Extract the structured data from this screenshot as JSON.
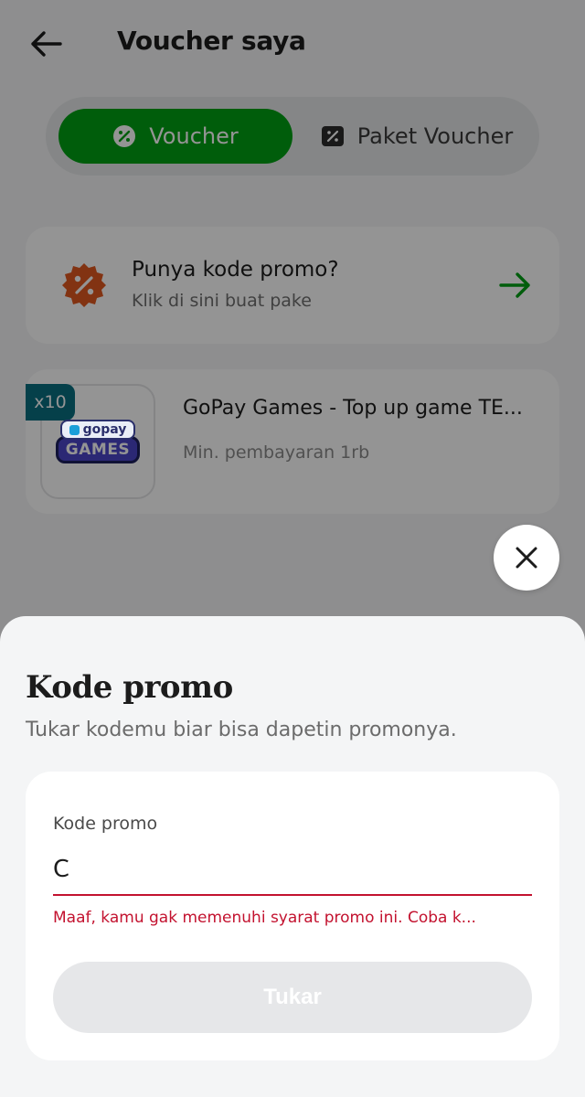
{
  "header": {
    "title": "Voucher saya",
    "back_icon": "arrow-left-icon"
  },
  "tabs": [
    {
      "label": "Voucher",
      "icon": "discount-icon",
      "active": true
    },
    {
      "label": "Paket Voucher",
      "icon": "ticket-icon",
      "active": false
    }
  ],
  "promo_entry": {
    "title": "Punya kode promo?",
    "subtitle": "Klik di sini buat pake",
    "icon": "percent-badge-icon",
    "arrow_icon": "arrow-right-icon"
  },
  "voucher": {
    "quantity": "x10",
    "logo_top": "gopay",
    "logo_bottom": "GAMES",
    "name": "GoPay Games - Top up game TE...",
    "min_payment": "Min. pembayaran 1rb"
  },
  "modal": {
    "close_icon": "close-icon",
    "title": "Kode promo",
    "subtitle": "Tukar kodemu biar bisa dapetin promonya.",
    "field_label": "Kode promo",
    "field_value_visible": "C",
    "error": "Maaf, kamu gak memenuhi syarat promo ini. Coba k...",
    "submit_label": "Tukar"
  },
  "colors": {
    "primary_green": "#00a013",
    "error_red": "#c3122f",
    "badge_teal": "#0a6e80",
    "promo_orange": "#e0581f"
  }
}
